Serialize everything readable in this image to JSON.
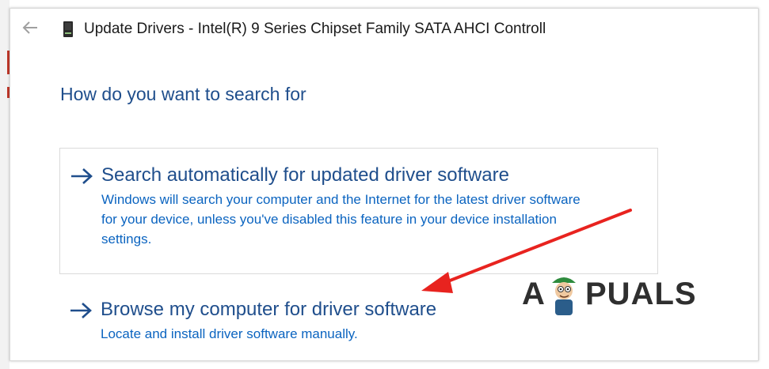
{
  "window": {
    "title": "Update Drivers - Intel(R) 9 Series Chipset Family SATA AHCI Controll"
  },
  "heading": "How do you want to search for",
  "options": [
    {
      "title": "Search automatically for updated driver software",
      "description_lines": [
        "Windows will search your computer and the Internet for the latest driver software",
        "for your device, unless you've disabled this feature in your device installation",
        "settings."
      ]
    },
    {
      "title": "Browse my computer for driver software",
      "description": "Locate and install driver software manually."
    }
  ],
  "watermark": {
    "letter_a": "A",
    "rest": "PUALS"
  },
  "icons": {
    "back": "back-arrow-icon",
    "device": "storage-controller-icon",
    "option": "right-arrow-icon",
    "annotation": "red-pointer-arrow"
  },
  "colors": {
    "heading": "#1f4e8c",
    "link": "#0b64c0",
    "annotation_arrow": "#e8231f",
    "option_border": "#dadada"
  }
}
